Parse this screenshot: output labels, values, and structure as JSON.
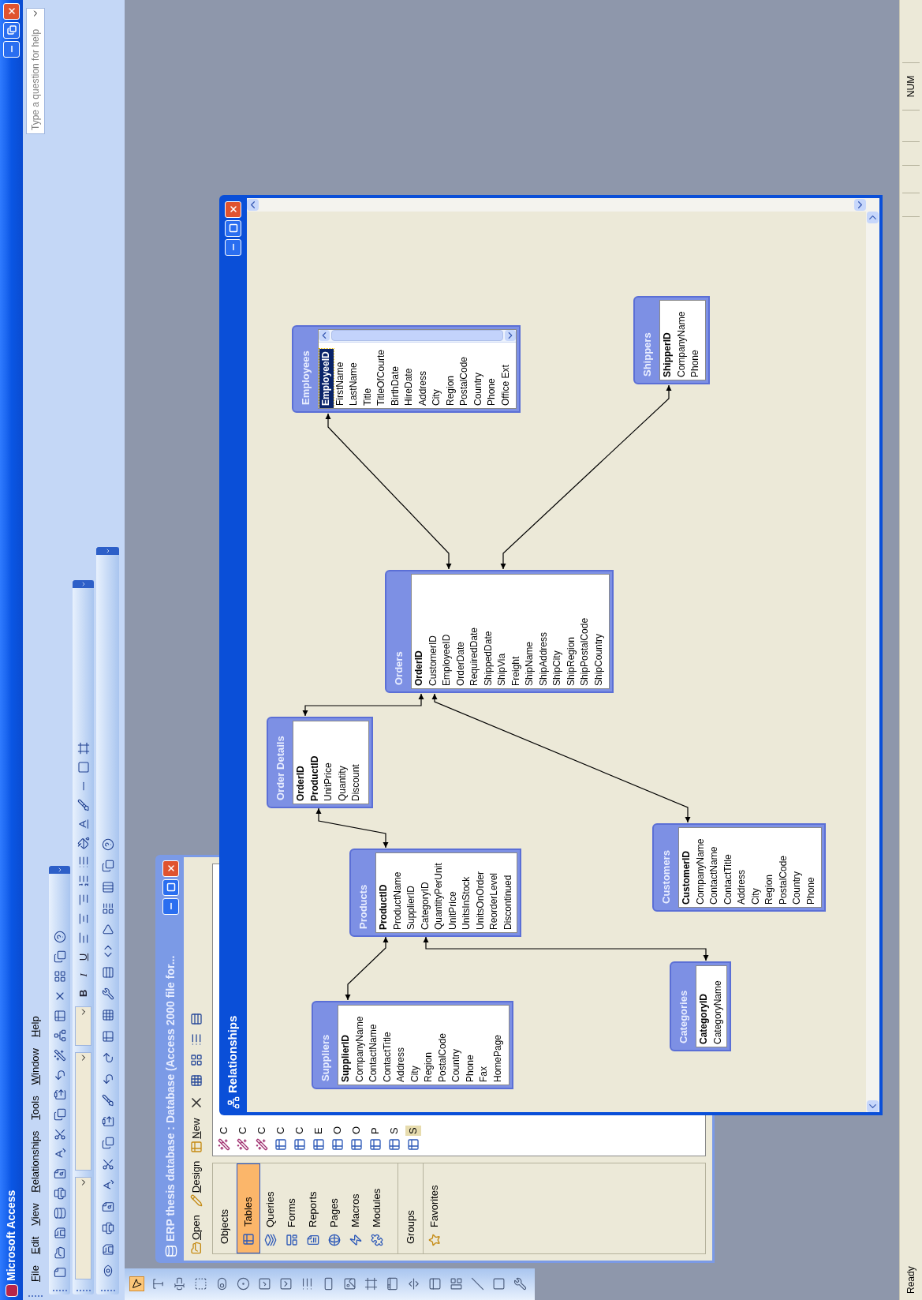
{
  "window": {
    "title": "Microsoft Access"
  },
  "menu": [
    "File",
    "Edit",
    "View",
    "Relationships",
    "Tools",
    "Window",
    "Help"
  ],
  "help_search": {
    "placeholder": "Type a question for help"
  },
  "formatting_toolbar": {
    "bold": "B",
    "italic": "I",
    "underline": "U"
  },
  "toolbox": [
    {
      "kind": "pointer",
      "selected": true
    },
    {
      "kind": "label",
      "selected": false
    },
    {
      "kind": "textbox",
      "selected": false
    },
    {
      "kind": "option-group",
      "selected": false
    },
    {
      "kind": "toggle",
      "selected": false
    },
    {
      "kind": "radio",
      "selected": false
    },
    {
      "kind": "checkbox",
      "selected": false
    },
    {
      "kind": "combo",
      "selected": false
    },
    {
      "kind": "listbox",
      "selected": false
    },
    {
      "kind": "button",
      "selected": false
    },
    {
      "kind": "image",
      "selected": false
    },
    {
      "kind": "unbound-frame",
      "selected": false
    },
    {
      "kind": "bound-frame",
      "selected": false
    },
    {
      "kind": "page-break",
      "selected": false
    },
    {
      "kind": "tab",
      "selected": false
    },
    {
      "kind": "subform",
      "selected": false
    },
    {
      "kind": "line",
      "selected": false
    },
    {
      "kind": "rectangle",
      "selected": false
    },
    {
      "kind": "more",
      "selected": false
    }
  ],
  "database_window": {
    "title": "ERP thesis database : Database (Access 2000 file for...",
    "toolbar": [
      "Open",
      "Design",
      "New"
    ],
    "objects_header": "Objects",
    "objects": [
      {
        "label": "Tables",
        "kind": "tables",
        "selected": true
      },
      {
        "label": "Queries",
        "kind": "queries",
        "selected": false
      },
      {
        "label": "Forms",
        "kind": "forms",
        "selected": false
      },
      {
        "label": "Reports",
        "kind": "reports",
        "selected": false
      },
      {
        "label": "Pages",
        "kind": "pages",
        "selected": false
      },
      {
        "label": "Macros",
        "kind": "macros",
        "selected": false
      },
      {
        "label": "Modules",
        "kind": "modules",
        "selected": false
      }
    ],
    "groups_header": "Groups",
    "groups": [
      {
        "label": "Favorites"
      }
    ],
    "list": [
      {
        "text": "C",
        "kind": "create",
        "selected": false
      },
      {
        "text": "C",
        "kind": "create",
        "selected": false
      },
      {
        "text": "C",
        "kind": "create",
        "selected": false
      },
      {
        "text": "C",
        "kind": "table",
        "selected": false
      },
      {
        "text": "C",
        "kind": "table",
        "selected": false
      },
      {
        "text": "E",
        "kind": "table",
        "selected": false
      },
      {
        "text": "O",
        "kind": "table",
        "selected": false
      },
      {
        "text": "O",
        "kind": "table",
        "selected": false
      },
      {
        "text": "P",
        "kind": "table",
        "selected": false
      },
      {
        "text": "S",
        "kind": "table",
        "selected": false
      },
      {
        "text": "S",
        "kind": "table",
        "selected": true
      }
    ]
  },
  "relationships_window": {
    "title": "Relationships",
    "tables": [
      {
        "name": "Suppliers",
        "scrollbar": false,
        "fields": [
          {
            "name": "SupplierID",
            "key": true,
            "selected": false
          },
          {
            "name": "CompanyName",
            "key": false,
            "selected": false
          },
          {
            "name": "ContactName",
            "key": false,
            "selected": false
          },
          {
            "name": "ContactTitle",
            "key": false,
            "selected": false
          },
          {
            "name": "Address",
            "key": false,
            "selected": false
          },
          {
            "name": "City",
            "key": false,
            "selected": false
          },
          {
            "name": "Region",
            "key": false,
            "selected": false
          },
          {
            "name": "PostalCode",
            "key": false,
            "selected": false
          },
          {
            "name": "Country",
            "key": false,
            "selected": false
          },
          {
            "name": "Phone",
            "key": false,
            "selected": false
          },
          {
            "name": "Fax",
            "key": false,
            "selected": false
          },
          {
            "name": "HomePage",
            "key": false,
            "selected": false
          }
        ]
      },
      {
        "name": "Products",
        "scrollbar": false,
        "fields": [
          {
            "name": "ProductID",
            "key": true,
            "selected": false
          },
          {
            "name": "ProductName",
            "key": false,
            "selected": false
          },
          {
            "name": "SupplierID",
            "key": false,
            "selected": false
          },
          {
            "name": "CategoryID",
            "key": false,
            "selected": false
          },
          {
            "name": "QuantityPerUnit",
            "key": false,
            "selected": false
          },
          {
            "name": "UnitPrice",
            "key": false,
            "selected": false
          },
          {
            "name": "UnitsInStock",
            "key": false,
            "selected": false
          },
          {
            "name": "UnitsOnOrder",
            "key": false,
            "selected": false
          },
          {
            "name": "ReorderLevel",
            "key": false,
            "selected": false
          },
          {
            "name": "Discontinued",
            "key": false,
            "selected": false
          }
        ]
      },
      {
        "name": "Order Details",
        "scrollbar": false,
        "fields": [
          {
            "name": "OrderID",
            "key": true,
            "selected": false
          },
          {
            "name": "ProductID",
            "key": true,
            "selected": false
          },
          {
            "name": "UnitPrice",
            "key": false,
            "selected": false
          },
          {
            "name": "Quantity",
            "key": false,
            "selected": false
          },
          {
            "name": "Discount",
            "key": false,
            "selected": false
          }
        ]
      },
      {
        "name": "Categories",
        "scrollbar": false,
        "fields": [
          {
            "name": "CategoryID",
            "key": true,
            "selected": false
          },
          {
            "name": "CategoryName",
            "key": false,
            "selected": false
          }
        ]
      },
      {
        "name": "Customers",
        "scrollbar": false,
        "fields": [
          {
            "name": "CustomerID",
            "key": true,
            "selected": false
          },
          {
            "name": "CompanyName",
            "key": false,
            "selected": false
          },
          {
            "name": "ContactName",
            "key": false,
            "selected": false
          },
          {
            "name": "ContactTitle",
            "key": false,
            "selected": false
          },
          {
            "name": "Address",
            "key": false,
            "selected": false
          },
          {
            "name": "City",
            "key": false,
            "selected": false
          },
          {
            "name": "Region",
            "key": false,
            "selected": false
          },
          {
            "name": "PostalCode",
            "key": false,
            "selected": false
          },
          {
            "name": "Country",
            "key": false,
            "selected": false
          },
          {
            "name": "Phone",
            "key": false,
            "selected": false
          }
        ]
      },
      {
        "name": "Orders",
        "scrollbar": false,
        "fields": [
          {
            "name": "OrderID",
            "key": true,
            "selected": false
          },
          {
            "name": "CustomerID",
            "key": false,
            "selected": false
          },
          {
            "name": "EmployeeID",
            "key": false,
            "selected": false
          },
          {
            "name": "OrderDate",
            "key": false,
            "selected": false
          },
          {
            "name": "RequiredDate",
            "key": false,
            "selected": false
          },
          {
            "name": "ShippedDate",
            "key": false,
            "selected": false
          },
          {
            "name": "ShipVia",
            "key": false,
            "selected": false
          },
          {
            "name": "Freight",
            "key": false,
            "selected": false
          },
          {
            "name": "ShipName",
            "key": false,
            "selected": false
          },
          {
            "name": "ShipAddress",
            "key": false,
            "selected": false
          },
          {
            "name": "ShipCity",
            "key": false,
            "selected": false
          },
          {
            "name": "ShipRegion",
            "key": false,
            "selected": false
          },
          {
            "name": "ShipPostalCode",
            "key": false,
            "selected": false
          },
          {
            "name": "ShipCountry",
            "key": false,
            "selected": false
          }
        ]
      },
      {
        "name": "Employees",
        "scrollbar": true,
        "fields": [
          {
            "name": "EmployeeID",
            "key": true,
            "selected": true
          },
          {
            "name": "FirstName",
            "key": false,
            "selected": false
          },
          {
            "name": "LastName",
            "key": false,
            "selected": false
          },
          {
            "name": "Title",
            "key": false,
            "selected": false
          },
          {
            "name": "TitleOfCourte",
            "key": false,
            "selected": false
          },
          {
            "name": "BirthDate",
            "key": false,
            "selected": false
          },
          {
            "name": "HireDate",
            "key": false,
            "selected": false
          },
          {
            "name": "Address",
            "key": false,
            "selected": false
          },
          {
            "name": "City",
            "key": false,
            "selected": false
          },
          {
            "name": "Region",
            "key": false,
            "selected": false
          },
          {
            "name": "PostalCode",
            "key": false,
            "selected": false
          },
          {
            "name": "Country",
            "key": false,
            "selected": false
          },
          {
            "name": "Phone",
            "key": false,
            "selected": false
          },
          {
            "name": "Office Ext",
            "key": false,
            "selected": false
          }
        ]
      },
      {
        "name": "Shippers",
        "scrollbar": false,
        "fields": [
          {
            "name": "ShipperID",
            "key": true,
            "selected": false
          },
          {
            "name": "CompanyName",
            "key": false,
            "selected": false
          },
          {
            "name": "Phone",
            "key": false,
            "selected": false
          }
        ]
      }
    ]
  },
  "status_bar": {
    "text": "Ready",
    "indicator": "NUM"
  }
}
